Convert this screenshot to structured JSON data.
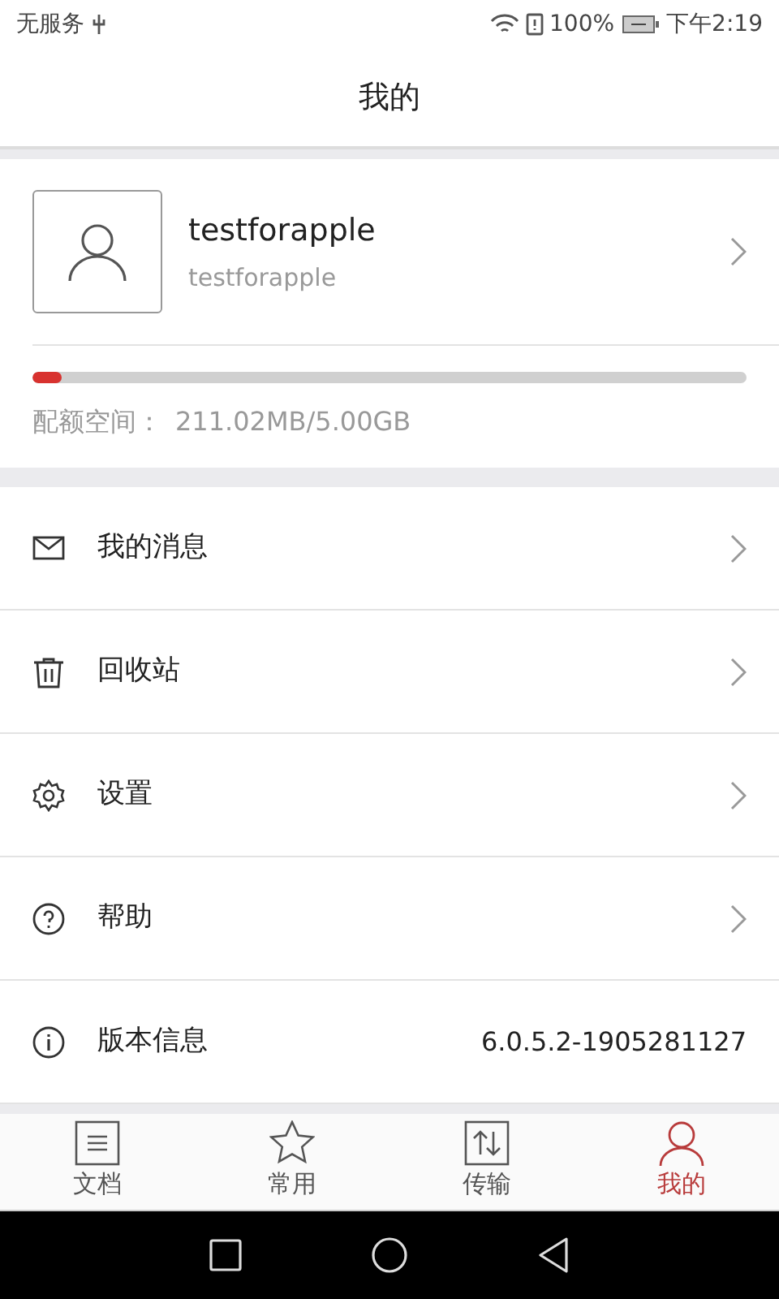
{
  "status_bar": {
    "carrier": "无服务",
    "battery": "100%",
    "time": "下午2:19"
  },
  "header": {
    "title": "我的"
  },
  "profile": {
    "name": "testforapple",
    "account": "testforapple"
  },
  "quota": {
    "level": 0.041,
    "label": "配额空间：",
    "value": "211.02MB/5.00GB"
  },
  "menu": [
    {
      "kind": "link",
      "label": "我的消息"
    },
    {
      "kind": "link",
      "label": "回收站"
    },
    {
      "kind": "link",
      "label": "设置"
    },
    {
      "kind": "link",
      "label": "帮助"
    },
    {
      "kind": "info",
      "label": "版本信息",
      "value": "6.0.5.2-1905281127"
    }
  ],
  "tabs": [
    {
      "label": "文档",
      "selected": false
    },
    {
      "label": "常用",
      "selected": false
    },
    {
      "label": "传输",
      "selected": false
    },
    {
      "label": "我的",
      "selected": true
    }
  ]
}
